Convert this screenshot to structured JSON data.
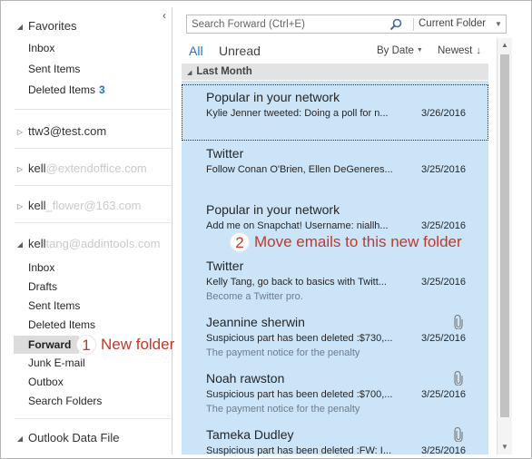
{
  "folder_pane": {
    "collapse_glyph": "‹",
    "favorites": {
      "label": "Favorites",
      "items": [
        {
          "label": "Inbox"
        },
        {
          "label": "Sent Items"
        },
        {
          "label": "Deleted Items",
          "count": "3"
        }
      ]
    },
    "accounts": [
      {
        "label": "ttw3@test.com"
      },
      {
        "label": "kell",
        "obscured": "@extendoffice.com"
      },
      {
        "label": "kell",
        "obscured": "_flower@163.com"
      },
      {
        "label": "kell",
        "obscured": "tang@addintools.com"
      }
    ],
    "expanded_items": [
      {
        "label": "Inbox"
      },
      {
        "label": "Drafts"
      },
      {
        "label": "Sent Items"
      },
      {
        "label": "Deleted Items"
      },
      {
        "label": "Forward",
        "selected": true
      },
      {
        "label": "Junk E-mail"
      },
      {
        "label": "Outbox"
      },
      {
        "label": "Search Folders"
      }
    ],
    "data_file": {
      "label": "Outlook Data File"
    }
  },
  "search": {
    "placeholder": "Search Forward (Ctrl+E)",
    "scope": "Current Folder"
  },
  "filter": {
    "all": "All",
    "unread": "Unread",
    "sort": "By Date",
    "order": "Newest"
  },
  "group_header": "Last Month",
  "messages": [
    {
      "sender": "Popular in your network",
      "subject": "Kylie Jenner tweeted: Doing a poll for n...",
      "date": "3/26/2016",
      "preview": "",
      "attachment": false,
      "focused": true
    },
    {
      "sender": "Twitter",
      "subject": "Follow Conan O'Brien, Ellen DeGeneres...",
      "date": "3/25/2016",
      "preview": "",
      "attachment": false
    },
    {
      "sender": "Popular in your network",
      "subject": "Add me on Snapchat! Username: niallh...",
      "date": "3/25/2016",
      "preview": "",
      "attachment": false
    },
    {
      "sender": "Twitter",
      "subject": "Kelly Tang, go back to basics with Twitt...",
      "date": "3/25/2016",
      "preview": "Become a Twitter pro.",
      "attachment": false
    },
    {
      "sender": "Jeannine sherwin",
      "subject": "Suspicious part has been deleted :$730,...",
      "date": "3/25/2016",
      "preview": "The payment notice for the penalty",
      "attachment": true
    },
    {
      "sender": "Noah rawston",
      "subject": "Suspicious part has been deleted :$700,...",
      "date": "3/25/2016",
      "preview": "The payment notice for the penalty",
      "attachment": true
    },
    {
      "sender": "Tameka Dudley",
      "subject": "Suspicious part has been deleted :FW: I...",
      "date": "3/25/2016",
      "preview": "",
      "attachment": true
    }
  ],
  "annotations": {
    "one_num": "1",
    "one_text": "New folder",
    "two_num": "2",
    "two_text": "Move emails  to this new folder"
  },
  "colors": {
    "accent": "#1e73c9",
    "selection": "#cce4f7",
    "annotation": "#c0392b"
  }
}
